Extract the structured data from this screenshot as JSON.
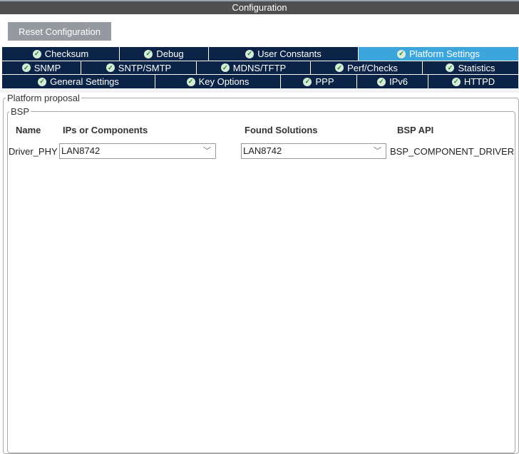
{
  "title": "Configuration",
  "reset_label": "Reset Configuration",
  "tabs_row1": [
    "Checksum",
    "Debug",
    "User Constants",
    "Platform Settings"
  ],
  "tabs_row2": [
    "SNMP",
    "SNTP/SMTP",
    "MDNS/TFTP",
    "Perf/Checks",
    "Statistics"
  ],
  "tabs_row3": [
    "General Settings",
    "Key Options",
    "PPP",
    "IPv6",
    "HTTPD"
  ],
  "active_tab": "Platform Settings",
  "platform_proposal": "Platform proposal",
  "bsp": {
    "legend": "BSP",
    "headers": {
      "name": "Name",
      "ips": "IPs or Components",
      "found": "Found Solutions",
      "api": "BSP API"
    },
    "row": {
      "name": "Driver_PHY",
      "ips": "LAN8742",
      "found": "LAN8742",
      "api": "BSP_COMPONENT_DRIVER"
    }
  },
  "check_mark": "✓",
  "chevron": "﹀"
}
